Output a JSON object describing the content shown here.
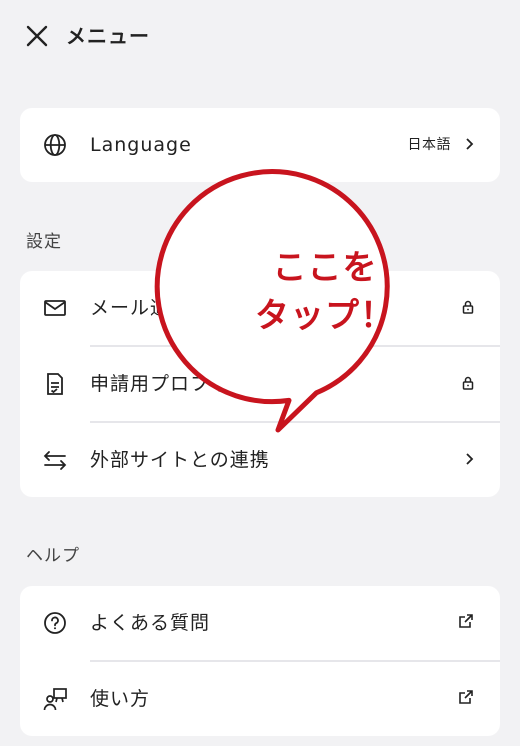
{
  "header": {
    "title": "メニュー"
  },
  "language": {
    "label": "Language",
    "value": "日本語"
  },
  "settings": {
    "title": "設定",
    "items": [
      {
        "label": "メール通知"
      },
      {
        "label": "申請用プロフィール"
      },
      {
        "label": "外部サイトとの連携"
      }
    ]
  },
  "help": {
    "title": "ヘルプ",
    "items": [
      {
        "label": "よくある質問"
      },
      {
        "label": "使い方"
      }
    ]
  },
  "callout": {
    "line1": "ここを",
    "line2": "タップ！"
  },
  "colors": {
    "accent": "#c8141e",
    "background": "#f2f2f4",
    "card": "#ffffff"
  },
  "icons": [
    "close-icon",
    "globe-icon",
    "mail-icon",
    "document-check-icon",
    "swap-arrows-icon",
    "question-circle-icon",
    "presenter-icon",
    "chevron-right-icon",
    "lock-icon",
    "external-link-icon"
  ]
}
